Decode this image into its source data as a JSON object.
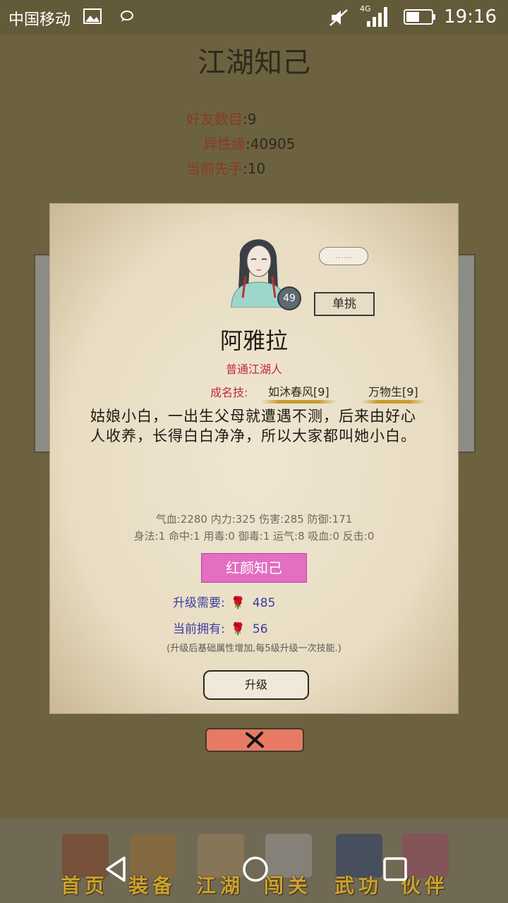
{
  "status_bar": {
    "carrier": "中国移动",
    "network": "4G",
    "time": "19:16"
  },
  "page": {
    "title": "江湖知己",
    "stats": [
      {
        "label": "好友数目",
        "value": "9"
      },
      {
        "label": "异性缘",
        "value": "40905"
      },
      {
        "label": "当前先手",
        "value": "10"
      }
    ]
  },
  "modal": {
    "level": "49",
    "bubble": "……",
    "duel_label": "单挑",
    "name": "阿雅拉",
    "rank": "普通江湖人",
    "skills_label": "成名技:",
    "skills": [
      "如沐春风[9]",
      "万物生[9]"
    ],
    "bio": "姑娘小白，一出生父母就遭遇不测，后来由好心人收养，长得白白净净，所以大家都叫她小白。",
    "attrs_line1": "气血:2280  内力:325  伤害:285  防御:171",
    "attrs_line2": "身法:1  命中:1  用毒:0  御毒:1  运气:8  吸血:0  反击:0",
    "beauty_button": "红颜知己",
    "upgrade_need_label": "升级需要:",
    "upgrade_need_value": "485",
    "owned_label": "当前拥有:",
    "owned_value": "56",
    "note": "(升级后基础属性增加,每5级升级一次技能.)",
    "upgrade_button": "升级",
    "close_icon": "close-x-icon"
  },
  "tabs": [
    {
      "label": "首页",
      "icon": "home-building-icon"
    },
    {
      "label": "装备",
      "icon": "armor-icon"
    },
    {
      "label": "江湖",
      "icon": "map-scroll-icon"
    },
    {
      "label": "闯关",
      "icon": "crossed-swords-icon"
    },
    {
      "label": "武功",
      "icon": "manual-book-icon"
    },
    {
      "label": "伙伴",
      "icon": "companions-icon"
    }
  ],
  "colors": {
    "accent_red": "#c22a3a",
    "beauty_pink": "#e46ec1",
    "close_coral": "#e87a63",
    "tab_gold": "#c9a230"
  }
}
